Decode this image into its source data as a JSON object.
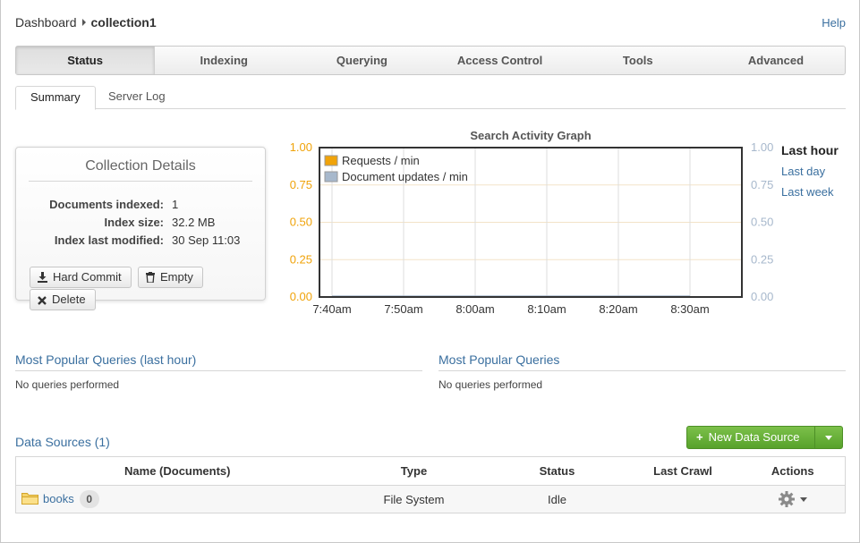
{
  "breadcrumb": {
    "root": "Dashboard",
    "current": "collection1"
  },
  "help_label": "Help",
  "main_tabs": [
    "Status",
    "Indexing",
    "Querying",
    "Access Control",
    "Tools",
    "Advanced"
  ],
  "active_main_tab": "Status",
  "sub_tabs": {
    "summary": "Summary",
    "server_log": "Server Log"
  },
  "details": {
    "title": "Collection Details",
    "documents_indexed_label": "Documents indexed:",
    "documents_indexed": "1",
    "index_size_label": "Index size:",
    "index_size": "32.2 MB",
    "last_modified_label": "Index last modified:",
    "last_modified": "30 Sep 11:03",
    "hard_commit": "Hard Commit",
    "empty": "Empty",
    "delete": "Delete"
  },
  "chart_data": {
    "type": "line",
    "title": "Search Activity Graph",
    "x": [
      "7:40am",
      "7:50am",
      "8:00am",
      "8:10am",
      "8:20am",
      "8:30am"
    ],
    "series": [
      {
        "name": "Requests / min",
        "values": [
          0,
          0,
          0,
          0,
          0,
          0
        ],
        "color": "#f0a30a"
      },
      {
        "name": "Document updates / min",
        "values": [
          0,
          0,
          0,
          0,
          0,
          0
        ],
        "color": "#a7b8cc"
      }
    ],
    "y_ticks": [
      "1.00",
      "0.75",
      "0.50",
      "0.25",
      "0.00"
    ],
    "ylim": [
      0,
      1
    ],
    "left_axis_color": "#f0a30a",
    "right_axis_color": "#a7b8cc",
    "legend": "top-left",
    "grid": true
  },
  "time_ranges": [
    "Last hour",
    "Last day",
    "Last week"
  ],
  "popular_last_hour": {
    "title": "Most Popular Queries (last hour)",
    "empty": "No queries performed"
  },
  "popular_all": {
    "title": "Most Popular Queries",
    "empty": "No queries performed"
  },
  "data_sources": {
    "title": "Data Sources (1)",
    "new_button": "New Data Source",
    "columns": [
      "Name (Documents)",
      "Type",
      "Status",
      "Last Crawl",
      "Actions"
    ],
    "rows": [
      {
        "name": "books",
        "count": "0",
        "type": "File System",
        "status": "Idle",
        "last_crawl": ""
      }
    ]
  },
  "colors": {
    "link": "#3a6f9f",
    "accent_green": "#62ab35",
    "orange": "#f0a30a"
  }
}
